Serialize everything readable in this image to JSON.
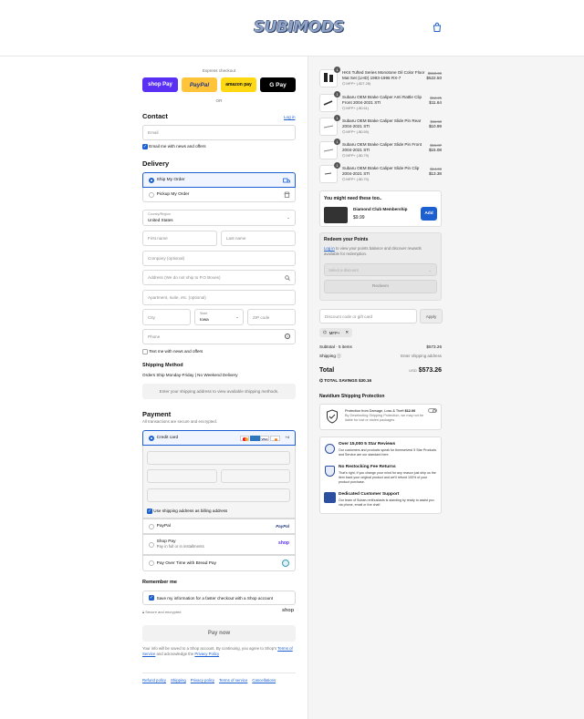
{
  "header": {
    "logo_text": "SUBIMODS",
    "cart_icon": "shopping-bag-icon"
  },
  "express": {
    "title": "Express checkout",
    "or": "OR",
    "buttons": [
      {
        "label": "shop Pay",
        "bg": "#5a31f4",
        "fg": "#ffffff"
      },
      {
        "label": "PayPal",
        "bg": "#ffc439",
        "fg": "#253b80"
      },
      {
        "label": "amazon pay",
        "bg": "#ffd814",
        "fg": "#111111"
      },
      {
        "label": "G Pay",
        "bg": "#000000",
        "fg": "#ffffff"
      }
    ]
  },
  "contact": {
    "title": "Contact",
    "login": "Log in",
    "email_placeholder": "Email",
    "news_label": "Email me with news and offers"
  },
  "delivery": {
    "title": "Delivery",
    "ship_label": "Ship My Order",
    "pickup_label": "Pickup My Order",
    "country_label": "Country/Region",
    "country_value": "United States",
    "first_name": "First name",
    "last_name": "Last name",
    "company": "Company (optional)",
    "address": "Address (We do not ship to P.O Boxes)",
    "apartment": "Apartment, suite, etc. (optional)",
    "city": "City",
    "state_label": "State",
    "state_value": "Iowa",
    "zip": "ZIP code",
    "phone": "Phone",
    "text_label": "Text me with news and offers"
  },
  "shipping": {
    "title": "Shipping Method",
    "note": "Orders Ship Monday-Friday | No Weekend Delivery",
    "info": "Enter your shipping address to view available shipping methods."
  },
  "payment": {
    "title": "Payment",
    "subtitle": "All transactions are secure and encrypted.",
    "credit_card": "Credit card",
    "more_cards": "+4",
    "billing_label": "Use shipping address as billing address",
    "paypal": "PayPal",
    "paypal_logo": "PayPal",
    "shoppay": "Shop Pay",
    "shoppay_sub": "Pay in full or in installments",
    "shoppay_logo": "shop",
    "bread": "Pay Over Time with Bread Pay"
  },
  "remember": {
    "title": "Remember me",
    "label": "Save my information for a faster checkout with a Shop account",
    "secure": "Secure and encrypted",
    "shop_logo": "shop"
  },
  "pay_now": "Pay now",
  "legal": {
    "text1": "Your info will be saved to a Shop account. By continuing, you agree to Shop's",
    "terms": "Terms of Service",
    "text2": "and acknowledge the",
    "privacy": "Privacy Policy"
  },
  "footer": {
    "links": [
      "Refund policy",
      "Shipping",
      "Privacy policy",
      "Terms of service",
      "Cancellations"
    ]
  },
  "cart": {
    "items": [
      {
        "qty": "1",
        "name": "HKS Tufted Series Monotone Oil Color Floor Mat Set (LHD) 1993-1995 RX-7",
        "discount": "MFP+ (-$27.28)",
        "old": "$550.00",
        "price": "$522.50"
      },
      {
        "qty": "1",
        "name": "Subaru OEM Brake Caliper Anti Rattle Clip Front 2004-2021 STI",
        "discount": "MFP+ (-$0.61)",
        "old": "$12.25",
        "price": "$11.64"
      },
      {
        "qty": "1",
        "name": "Subaru OEM Brake Caliper Slide Pin Rear 2004-2021 STI",
        "discount": "MFP+ (-$0.59)",
        "old": "$11.58",
        "price": "$10.99"
      },
      {
        "qty": "1",
        "name": "Subaru OEM Brake Caliper Slide Pin Front 2004-2021 STI",
        "discount": "MFP+ (-$0.79)",
        "old": "$15.87",
        "price": "$15.08"
      },
      {
        "qty": "1",
        "name": "Subaru OEM Brake Caliper Slide Pin Clip 2004-2021 STI",
        "discount": "MFP+ (-$0.70)",
        "old": "$14.08",
        "price": "$13.38"
      }
    ]
  },
  "upsell": {
    "title": "You might need these too..",
    "name": "Diamond Club Membership",
    "price": "$9.99",
    "add": "Add"
  },
  "points": {
    "title": "Redeem your Points",
    "login": "Log in",
    "text": "to view your points balance and discover rewards available for redemption.",
    "select": "Select a discount",
    "redeem": "Redeem"
  },
  "discount": {
    "placeholder": "Discount code or gift card",
    "apply": "Apply",
    "tag": "MFP+"
  },
  "totals": {
    "subtotal_label": "Subtotal · 5 items",
    "subtotal": "$573.26",
    "shipping_label": "Shipping",
    "shipping": "Enter shipping address",
    "total_label": "Total",
    "currency": "USD",
    "total": "$573.26",
    "savings_label": "TOTAL SAVINGS",
    "savings": "$30.16"
  },
  "protection": {
    "title": "Navidium Shipping Protection",
    "price_text": "Protection from Damage, Loss & Theft",
    "price": "$12.00",
    "desc": "By Deselecting Shipping Protection, we may not be liable for lost or stolen packages"
  },
  "features": [
    {
      "title": "Over 15,000 5 Star Reviews",
      "text": "Our customers and products speak for themselves! 5 Star Products and Service are our standard here."
    },
    {
      "title": "No Restocking Fee Returns",
      "text": "That's right, if you change your mind for any reason just ship us the item back your original product and we'll refund 100% of your product purchase."
    },
    {
      "title": "Dedicated Customer Support",
      "text": "Our team of Subaru enthusiasts is standing by ready to assist you via phone, email or live chat!"
    }
  ]
}
